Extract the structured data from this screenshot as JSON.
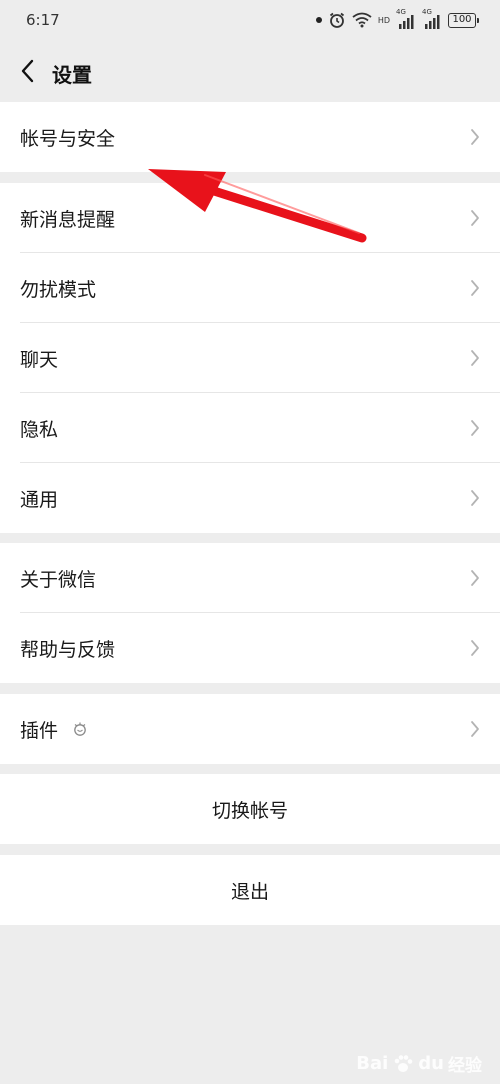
{
  "status_bar": {
    "time": "6:17",
    "net1": "4G",
    "net2": "4G",
    "hd": "HD",
    "battery": "100"
  },
  "nav": {
    "title": "设置"
  },
  "groups": {
    "account": [
      "帐号与安全"
    ],
    "main": [
      "新消息提醒",
      "勿扰模式",
      "聊天",
      "隐私",
      "通用"
    ],
    "about": [
      "关于微信",
      "帮助与反馈"
    ],
    "plugins": [
      "插件"
    ]
  },
  "actions": {
    "switch_account": "切换帐号",
    "logout": "退出"
  },
  "watermark": {
    "brand": "Bai",
    "brand_suffix": "du",
    "product": "经验"
  },
  "colors": {
    "background": "#ededed",
    "cell": "#ffffff",
    "annotation_arrow": "#e8121b"
  }
}
